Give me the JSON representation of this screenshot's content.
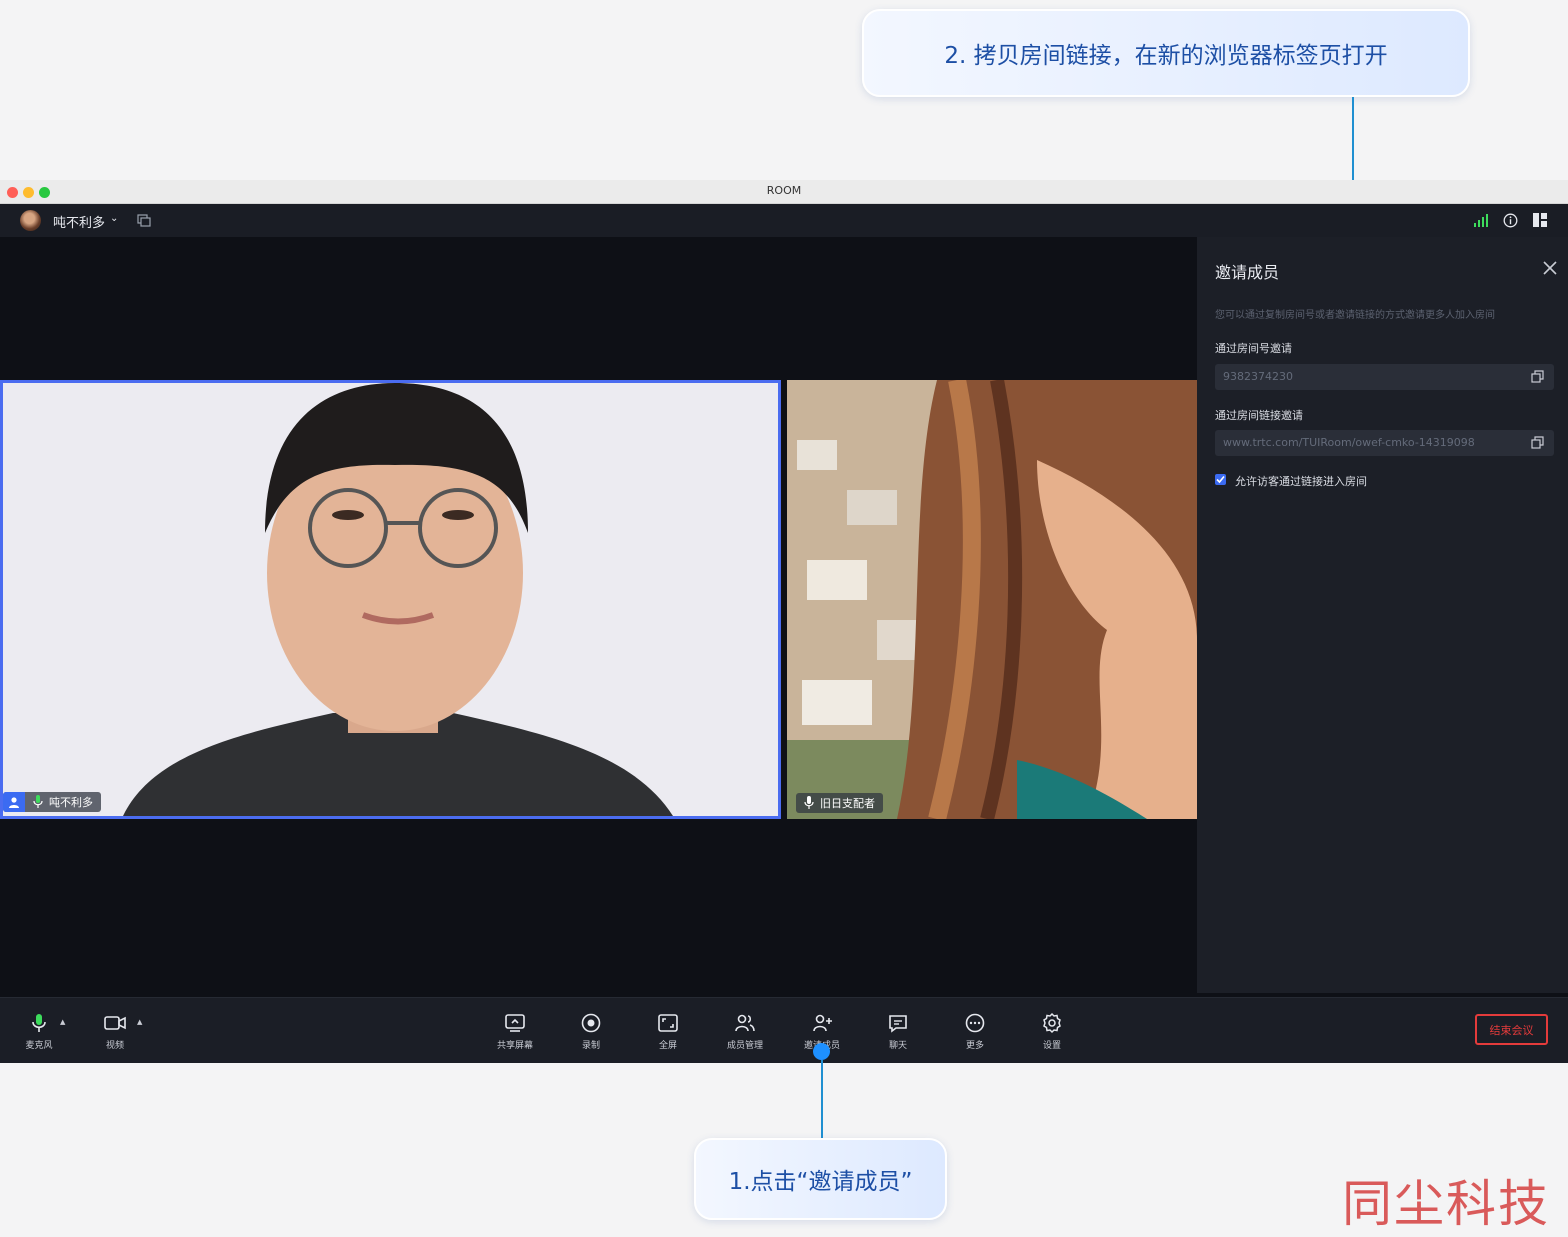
{
  "annotations": {
    "top_callout": "2. 拷贝房间链接，在新的浏览器标签页打开",
    "bottom_callout": "1.点击“邀请成员”"
  },
  "window": {
    "title": "ROOM",
    "traffic_lights": [
      "#ff5f57",
      "#febc2e",
      "#28c840"
    ]
  },
  "topbar": {
    "username": "吨不利多",
    "signal_color": "#3ddc5c"
  },
  "video_tiles": [
    {
      "name": "吨不利多",
      "active": true
    },
    {
      "name": "旧日支配者",
      "active": false
    }
  ],
  "invite_panel": {
    "title": "邀请成员",
    "description": "您可以通过复制房间号或者邀请链接的方式邀请更多人加入房间",
    "room_id_label": "通过房间号邀请",
    "room_id": "9382374230",
    "room_link_label": "通过房间链接邀请",
    "room_link": "www.trtc.com/TUIRoom/owef-cmko-14319098",
    "guest_checkbox_label": "允许访客通过链接进入房间",
    "guest_checkbox_checked": true
  },
  "toolbar": {
    "mic": "麦克风",
    "video": "视频",
    "items": [
      "共享屏幕",
      "录制",
      "全屏",
      "成员管理",
      "邀请成员",
      "聊天",
      "更多",
      "设置"
    ],
    "end_meeting": "结束会议",
    "accent_active_mic": "#3ddc5c",
    "end_color": "#e43b3b"
  },
  "watermark": "同尘科技"
}
